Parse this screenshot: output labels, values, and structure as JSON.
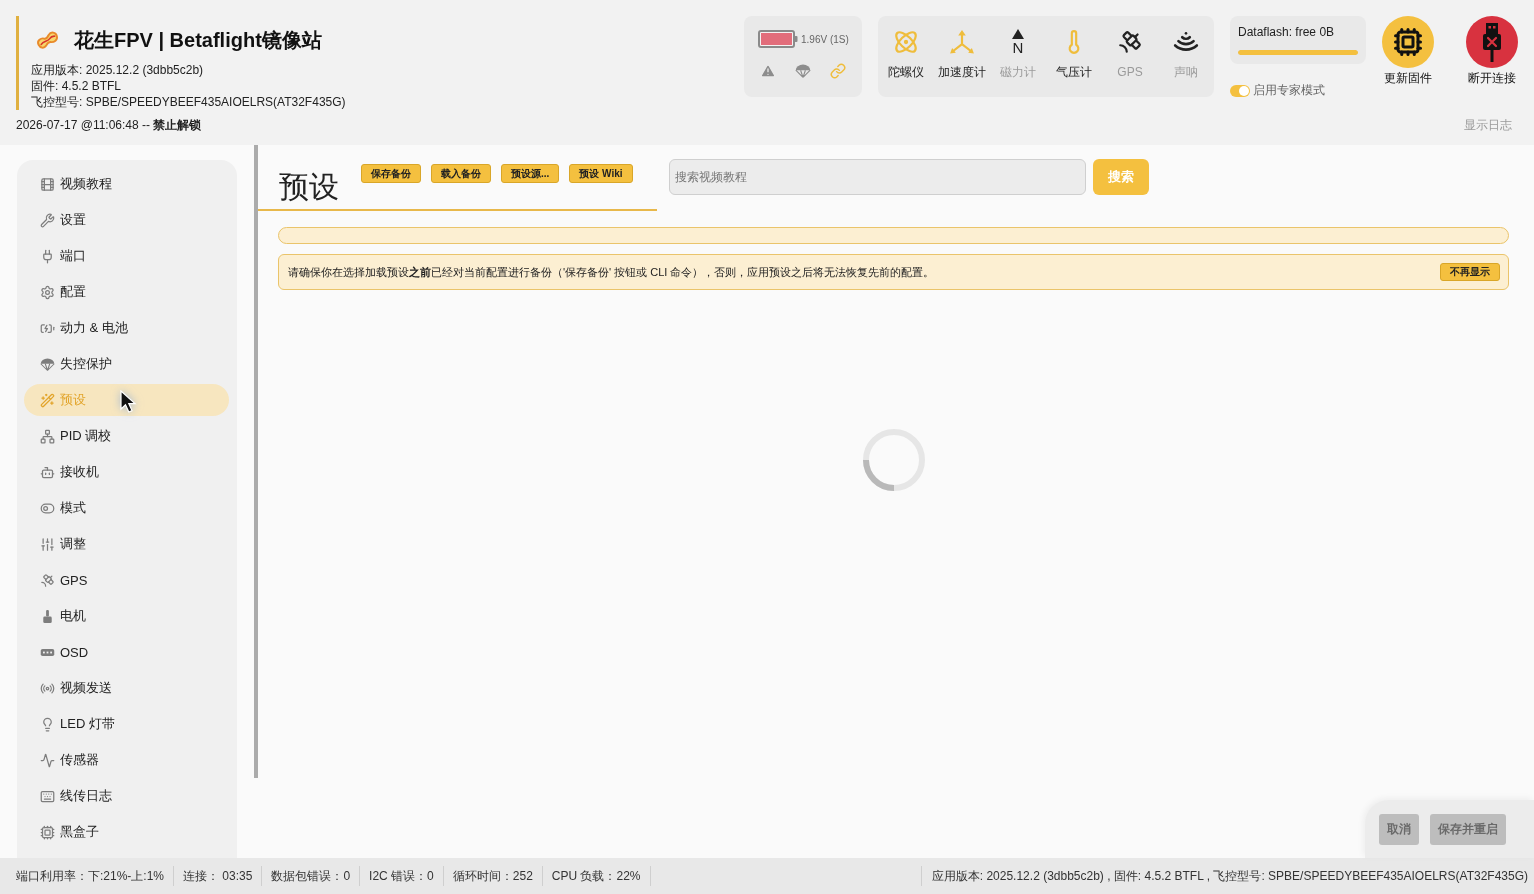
{
  "header": {
    "title": "花生FPV | Betaflight镜像站",
    "info_lines": [
      "应用版本: 2025.12.2 (3dbb5c2b)",
      "固件: 4.5.2 BTFL",
      "飞控型号: SPBE/SPEEDYBEEF435AIOELRS(AT32F435G)"
    ],
    "arming_status": "2026-07-17 @11:06:48 -- **禁止解锁**",
    "show_log": "显示日志"
  },
  "battery": {
    "reading": "1.96V (1S)"
  },
  "indicators": [
    {
      "kind": "warning",
      "active": false
    },
    {
      "kind": "failsafe",
      "active": false
    },
    {
      "kind": "link",
      "active": true
    }
  ],
  "sensors": [
    {
      "kind": "gyro",
      "label": "陀螺仪",
      "active": true
    },
    {
      "kind": "accel",
      "label": "加速度计",
      "active": true
    },
    {
      "kind": "mag",
      "label": "磁力计",
      "active": false,
      "symbol": "N"
    },
    {
      "kind": "baro",
      "label": "气压计",
      "active": true
    },
    {
      "kind": "gps",
      "label": "GPS",
      "active": false
    },
    {
      "kind": "sonar",
      "label": "声呐",
      "active": false
    }
  ],
  "dataflash": {
    "label": "Dataflash: free 0B",
    "level": 1
  },
  "expert_mode": {
    "label": "启用专家模式",
    "on": true
  },
  "actions": [
    {
      "kind": "firmware",
      "label": "更新固件"
    },
    {
      "kind": "disconnect",
      "label": "断开连接"
    }
  ],
  "sidebar": {
    "items": [
      {
        "label": "视频教程",
        "selected": false
      },
      {
        "label": "设置",
        "selected": false
      },
      {
        "label": "端口",
        "selected": false
      },
      {
        "label": "配置",
        "selected": false
      },
      {
        "label": "动力 & 电池",
        "selected": false
      },
      {
        "label": "失控保护",
        "selected": false
      },
      {
        "label": "预设",
        "selected": true
      },
      {
        "label": "PID 调校",
        "selected": false
      },
      {
        "label": "接收机",
        "selected": false
      },
      {
        "label": "模式",
        "selected": false
      },
      {
        "label": "调整",
        "selected": false
      },
      {
        "label": "GPS",
        "selected": false
      },
      {
        "label": "电机",
        "selected": false
      },
      {
        "label": "OSD",
        "selected": false
      },
      {
        "label": "视频发送",
        "selected": false
      },
      {
        "label": "LED 灯带",
        "selected": false
      },
      {
        "label": "传感器",
        "selected": false
      },
      {
        "label": "线传日志",
        "selected": false
      },
      {
        "label": "黑盒子",
        "selected": false
      }
    ]
  },
  "page": {
    "title": "预设",
    "buttons": [
      "保存备份",
      "载入备份",
      "预设源...",
      "预设 Wiki"
    ],
    "search": {
      "placeholder": "搜索视频教程",
      "button": "搜索"
    },
    "notice": {
      "text": "请确保你在选择加载预设**之前**已经对当前配置进行备份（'保存备份' 按钮或 CLI 命令），否则，应用预设之后将无法恢复先前的配置。",
      "dismiss": "不再显示"
    },
    "loading": true
  },
  "footer_buttons": [
    {
      "label": "取消",
      "disabled": true
    },
    {
      "label": "保存并重启",
      "disabled": true
    }
  ],
  "status_bar": {
    "items": [
      "端口利用率：下:21%-上:1%",
      "连接： 03:35",
      "数据包错误：0",
      "I2C 错误：0",
      "循环时间：252",
      "CPU 负载：22%"
    ],
    "version": "应用版本: 2025.12.2 (3dbb5c2b) , 固件: 4.5.2 BTFL , 飞控型号: SPBE/SPEEDYBEEF435AIOELRS(AT32F435G)"
  }
}
